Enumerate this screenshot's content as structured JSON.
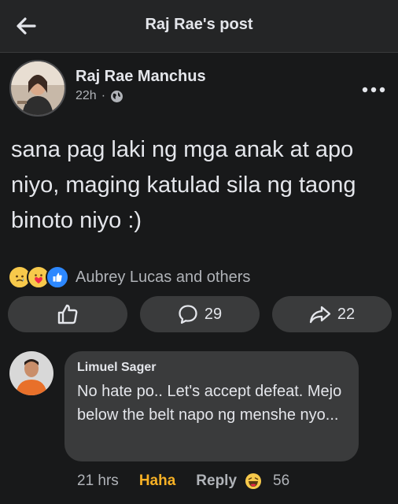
{
  "header": {
    "title": "Raj Rae's post",
    "back_icon": "arrow-left-icon"
  },
  "post": {
    "author": "Raj Rae Manchus",
    "time": "22h",
    "privacy_icon": "globe-icon",
    "text": "sana pag laki ng mga anak at apo niyo, maging katulad sila ng taong binoto niyo :)",
    "reaction_icons": [
      "sad-reaction-icon",
      "care-reaction-icon",
      "like-reaction-icon"
    ],
    "reaction_names": "Aubrey Lucas and others"
  },
  "actions": {
    "like_icon": "thumbs-up-icon",
    "comment_icon": "comment-icon",
    "comment_count": "29",
    "share_icon": "share-icon",
    "share_count": "22"
  },
  "comment": {
    "author": "Limuel Sager",
    "text": "No hate po.. Let's accept defeat. Mejo below the belt napo ng menshe nyo...",
    "time": "21 hrs",
    "reaction_label": "Haha",
    "reply_label": "Reply",
    "reaction_icon": "haha-reaction-icon",
    "reaction_count": "56"
  },
  "colors": {
    "background": "#18191a",
    "surface": "#3a3b3c",
    "text": "#e4e6eb",
    "secondary": "#b0b3b8",
    "haha": "#f7b125",
    "like_blue": "#2d88ff"
  }
}
